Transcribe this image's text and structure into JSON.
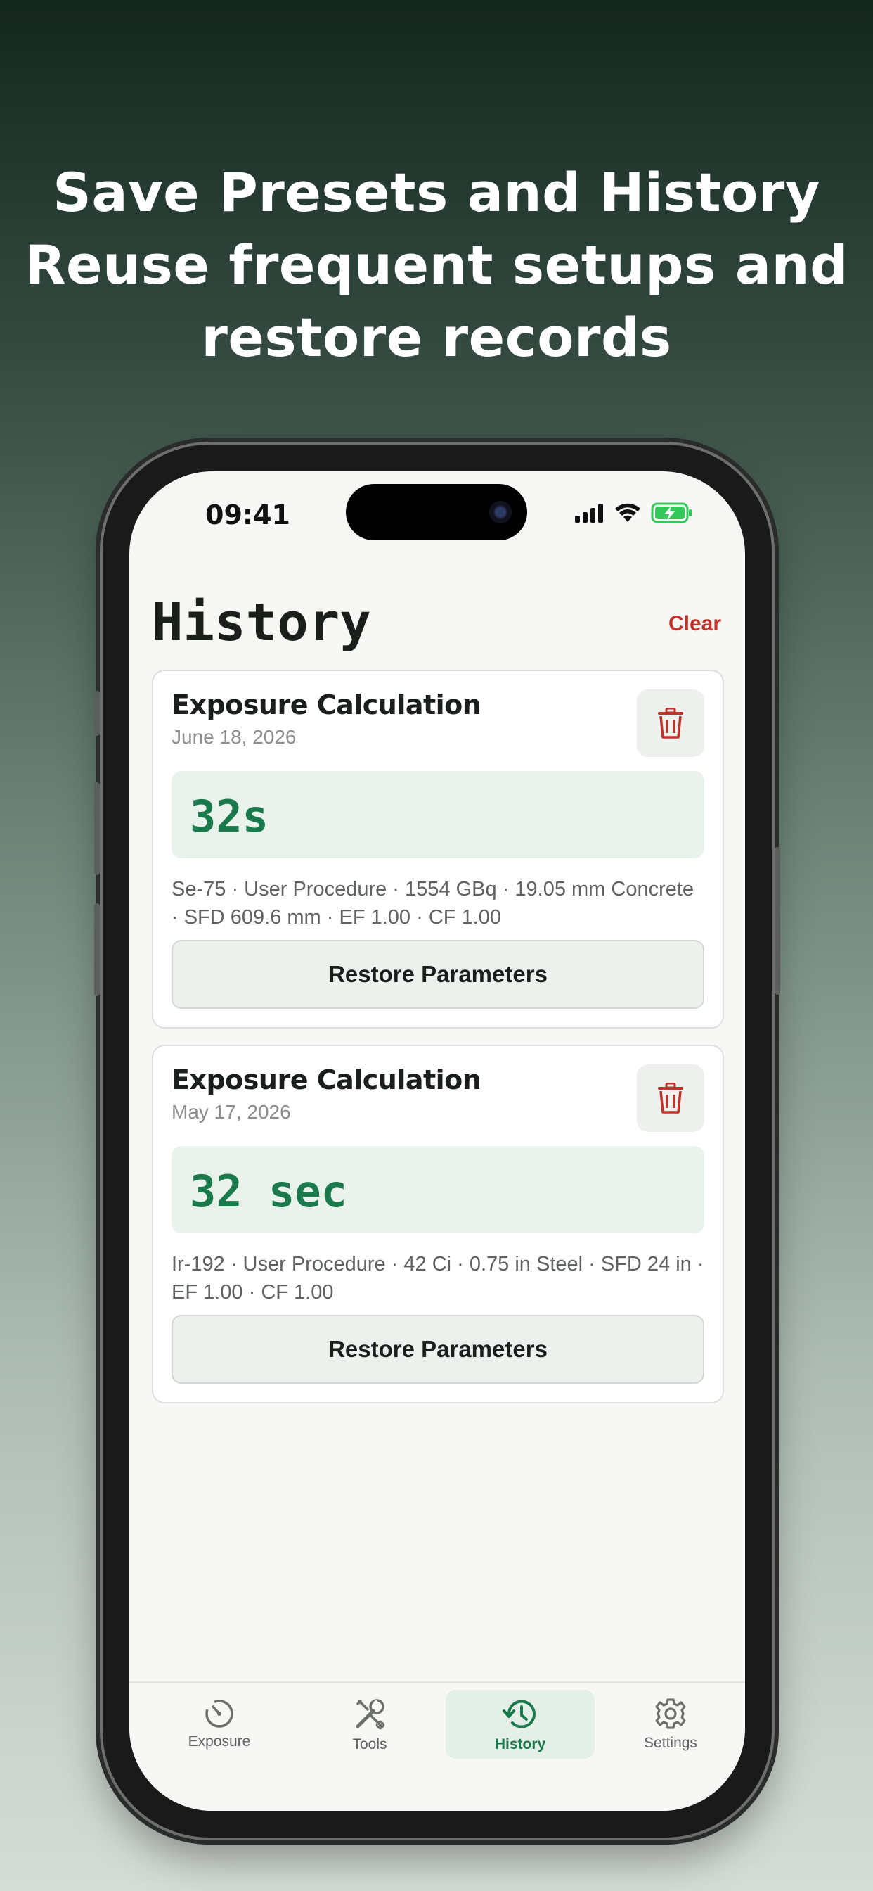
{
  "headline": {
    "line1": "Save Presets and History",
    "line2": "Reuse frequent setups and",
    "line3": "restore records"
  },
  "status_bar": {
    "time": "09:41"
  },
  "page": {
    "title": "History",
    "clear_label": "Clear"
  },
  "history": [
    {
      "title": "Exposure Calculation",
      "date": "June 18, 2026",
      "result": "32s",
      "details": "Se-75 · User Procedure · 1554 GBq · 19.05 mm Concrete · SFD 609.6 mm · EF 1.00 · CF 1.00",
      "restore_label": "Restore Parameters"
    },
    {
      "title": "Exposure Calculation",
      "date": "May 17, 2026",
      "result": "32 sec",
      "details": "Ir-192 · User Procedure · 42 Ci · 0.75 in Steel · SFD 24 in · EF 1.00 · CF 1.00",
      "restore_label": "Restore Parameters"
    }
  ],
  "tabs": [
    {
      "label": "Exposure",
      "icon": "gauge-icon"
    },
    {
      "label": "Tools",
      "icon": "tools-icon"
    },
    {
      "label": "History",
      "icon": "history-icon",
      "active": true
    },
    {
      "label": "Settings",
      "icon": "gear-icon"
    }
  ],
  "colors": {
    "accent": "#1a7a4b",
    "danger": "#c0322b"
  }
}
